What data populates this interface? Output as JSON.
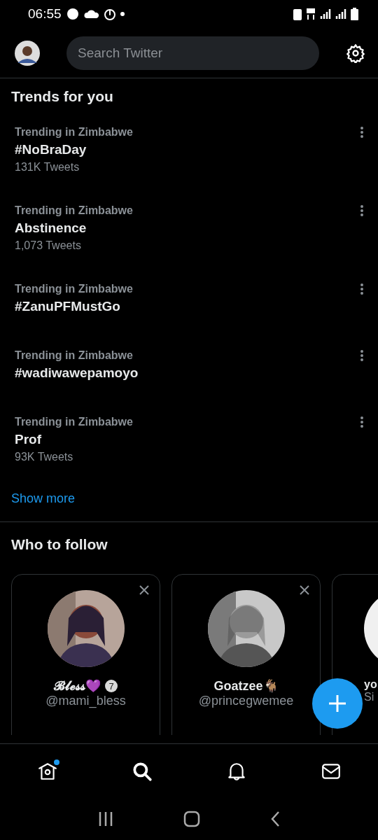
{
  "status_bar": {
    "time": "06:55"
  },
  "header": {
    "search": {
      "placeholder": "Search Twitter"
    }
  },
  "trends": {
    "title": "Trends for you",
    "items": [
      {
        "category": "Trending in Zimbabwe",
        "name": "#NoBraDay",
        "count": "131K Tweets"
      },
      {
        "category": "Trending in Zimbabwe",
        "name": "Abstinence",
        "count": "1,073 Tweets"
      },
      {
        "category": "Trending in Zimbabwe",
        "name": "#ZanuPFMustGo"
      },
      {
        "category": "Trending in Zimbabwe",
        "name": "#wadiwawepamoyo"
      },
      {
        "category": "Trending in Zimbabwe",
        "name": "Prof",
        "count": "93K Tweets"
      }
    ],
    "show_more": "Show more"
  },
  "who_to_follow": {
    "title": "Who to follow",
    "cards": [
      {
        "name": "𝓑𝓵𝓮𝓼𝓼💜",
        "badge": "7",
        "handle": "@mami_bless"
      },
      {
        "name": "Goatzee🐐",
        "handle": "@princegwemee"
      },
      {
        "name": "yo",
        "handle": "Si"
      }
    ]
  },
  "bottom_nav": [
    {
      "kind": "home",
      "selected": false,
      "dot": true
    },
    {
      "kind": "search",
      "selected": true,
      "dot": false
    },
    {
      "kind": "bell",
      "selected": false,
      "dot": false
    },
    {
      "kind": "mail",
      "selected": false,
      "dot": false
    }
  ]
}
